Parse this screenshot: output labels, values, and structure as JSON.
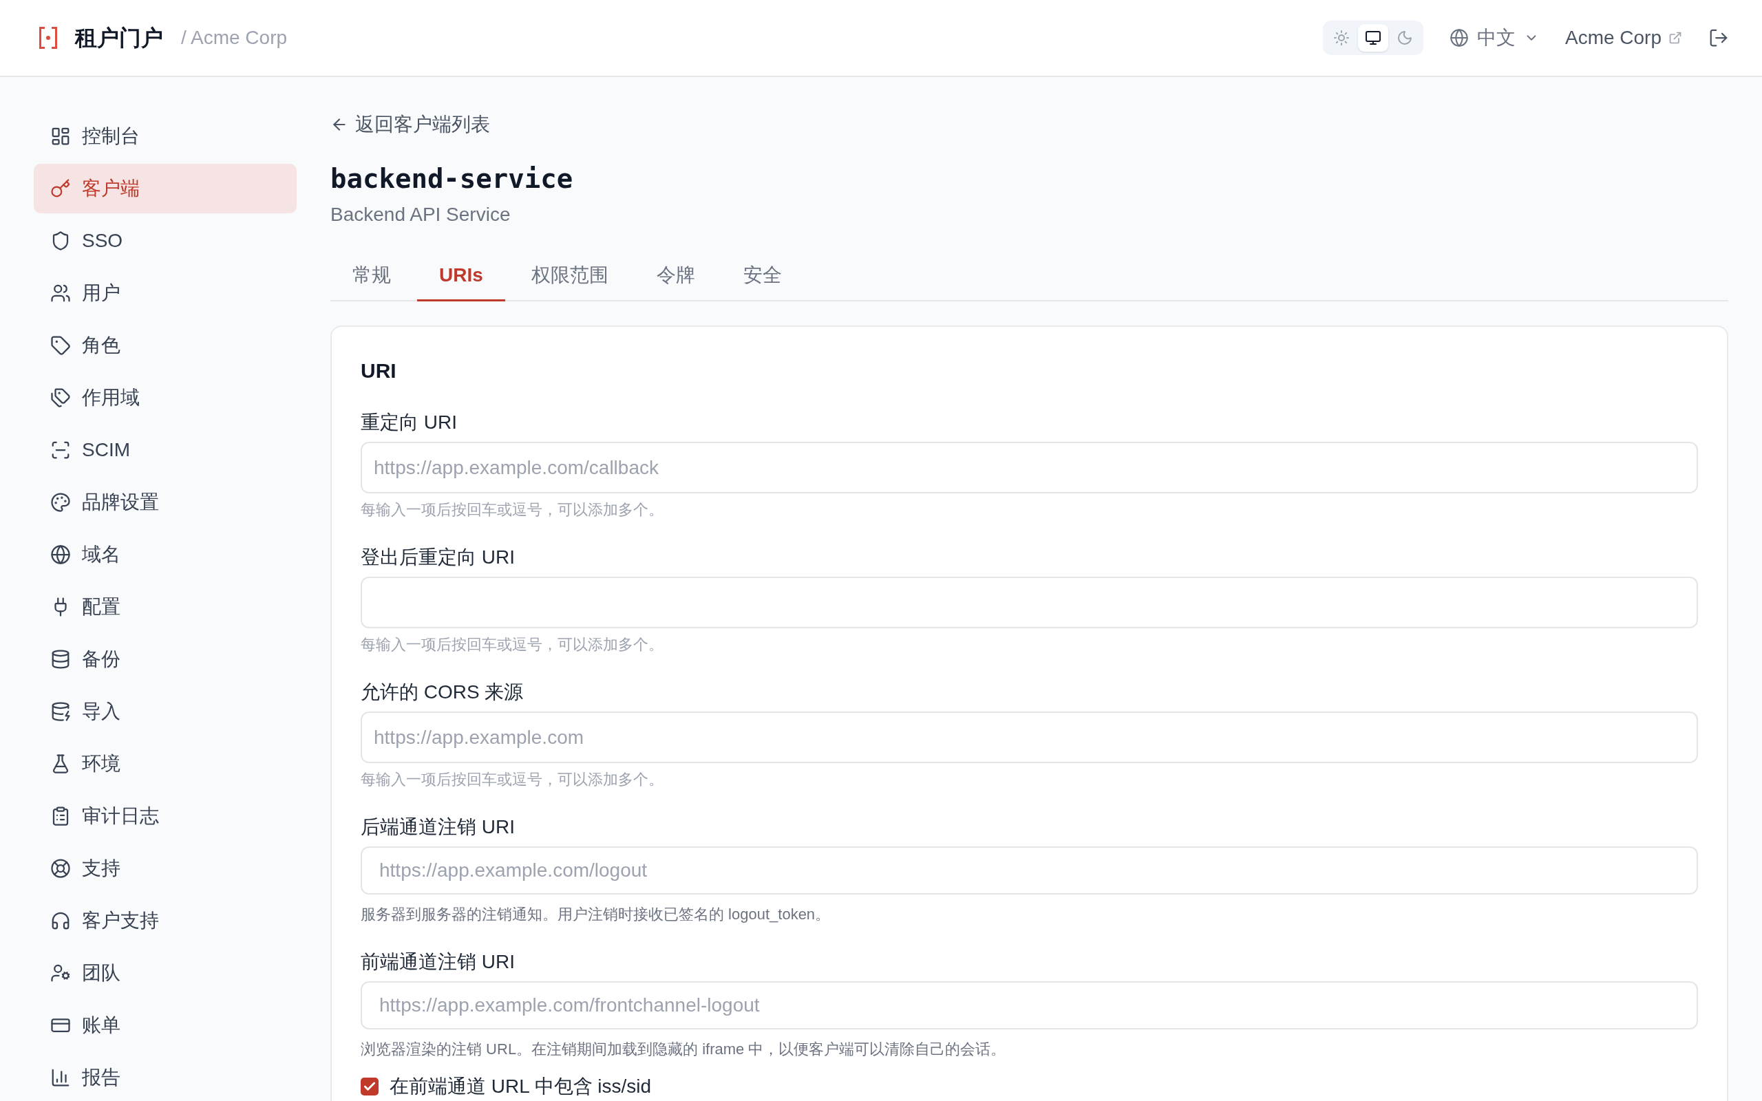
{
  "header": {
    "logo_title": "租户门户",
    "breadcrumb": "/ Acme Corp",
    "theme_options": [
      {
        "kind": "light",
        "selected": false
      },
      {
        "kind": "system",
        "selected": true
      },
      {
        "kind": "dark",
        "selected": false
      }
    ],
    "language": "中文",
    "org_link": "Acme Corp"
  },
  "sidebar": {
    "items": [
      {
        "label": "控制台",
        "selected": false
      },
      {
        "label": "客户端",
        "selected": true
      },
      {
        "label": "SSO",
        "selected": false
      },
      {
        "label": "用户",
        "selected": false
      },
      {
        "label": "角色",
        "selected": false
      },
      {
        "label": "作用域",
        "selected": false
      },
      {
        "label": "SCIM",
        "selected": false
      },
      {
        "label": "品牌设置",
        "selected": false
      },
      {
        "label": "域名",
        "selected": false
      },
      {
        "label": "配置",
        "selected": false
      },
      {
        "label": "备份",
        "selected": false
      },
      {
        "label": "导入",
        "selected": false
      },
      {
        "label": "环境",
        "selected": false
      },
      {
        "label": "审计日志",
        "selected": false
      },
      {
        "label": "支持",
        "selected": false
      },
      {
        "label": "客户支持",
        "selected": false
      },
      {
        "label": "团队",
        "selected": false
      },
      {
        "label": "账单",
        "selected": false
      },
      {
        "label": "报告",
        "selected": false
      }
    ]
  },
  "back_link": "返回客户端列表",
  "client": {
    "name": "backend-service",
    "description": "Backend API Service"
  },
  "tabs": [
    {
      "label": "常规",
      "selected": false
    },
    {
      "label": "URIs",
      "selected": true
    },
    {
      "label": "权限范围",
      "selected": false
    },
    {
      "label": "令牌",
      "selected": false
    },
    {
      "label": "安全",
      "selected": false
    }
  ],
  "card": {
    "title": "URI",
    "fields": [
      {
        "kind": "tags",
        "label": "重定向 URI",
        "placeholder": "https://app.example.com/callback",
        "hint": "每输入一项后按回车或逗号，可以添加多个。"
      },
      {
        "kind": "tags",
        "label": "登出后重定向 URI",
        "hint": "每输入一项后按回车或逗号，可以添加多个。"
      },
      {
        "kind": "tags",
        "label": "允许的 CORS 来源",
        "placeholder": "https://app.example.com",
        "hint": "每输入一项后按回车或逗号，可以添加多个。"
      },
      {
        "kind": "text",
        "label": "后端通道注销 URI",
        "placeholder": "https://app.example.com/logout",
        "hint": "服务器到服务器的注销通知。用户注销时接收已签名的 logout_token。"
      },
      {
        "kind": "text",
        "label": "前端通道注销 URI",
        "placeholder": "https://app.example.com/frontchannel-logout",
        "hint": "浏览器渲染的注销 URL。在注销期间加载到隐藏的 iframe 中，以便客户端可以清除自己的会话。"
      }
    ],
    "checkbox": {
      "label": "在前端通道 URL 中包含 iss/sid",
      "checked": true
    }
  }
}
